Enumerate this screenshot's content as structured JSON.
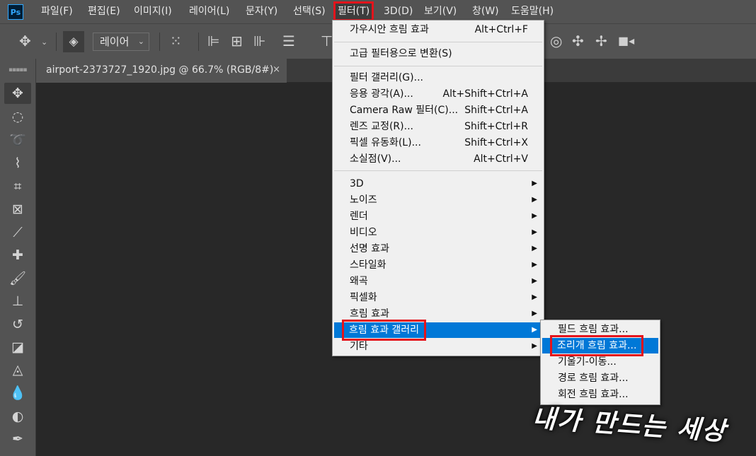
{
  "app": {
    "logo": "Ps"
  },
  "menubar": [
    {
      "label": "파일(F)",
      "active": false
    },
    {
      "label": "편집(E)",
      "active": false
    },
    {
      "label": "이미지(I)",
      "active": false
    },
    {
      "label": "레이어(L)",
      "active": false
    },
    {
      "label": "문자(Y)",
      "active": false
    },
    {
      "label": "선택(S)",
      "active": false
    },
    {
      "label": "필터(T)",
      "active": true
    },
    {
      "label": "3D(D)",
      "active": false
    },
    {
      "label": "보기(V)",
      "active": false
    },
    {
      "label": "창(W)",
      "active": false
    },
    {
      "label": "도움말(H)",
      "active": false
    }
  ],
  "options": {
    "target_select": "레이어"
  },
  "document_tab": {
    "title": "airport-2373727_1920.jpg @ 66.7% (RGB/8#)",
    "close": "×"
  },
  "filter_menu": {
    "items": [
      {
        "label": "가우시안 흐림 효과",
        "shortcut": "Alt+Ctrl+F"
      },
      {
        "label": "고급 필터용으로 변환(S)",
        "shortcut": ""
      },
      {
        "label": "필터 갤러리(G)...",
        "shortcut": ""
      },
      {
        "label": "응용 광각(A)...",
        "shortcut": "Alt+Shift+Ctrl+A"
      },
      {
        "label": "Camera Raw 필터(C)...",
        "shortcut": "Shift+Ctrl+A"
      },
      {
        "label": "렌즈 교정(R)...",
        "shortcut": "Shift+Ctrl+R"
      },
      {
        "label": "픽셀 유동화(L)...",
        "shortcut": "Shift+Ctrl+X"
      },
      {
        "label": "소실점(V)...",
        "shortcut": "Alt+Ctrl+V"
      },
      {
        "label": "3D",
        "submenu": true
      },
      {
        "label": "노이즈",
        "submenu": true
      },
      {
        "label": "렌더",
        "submenu": true
      },
      {
        "label": "비디오",
        "submenu": true
      },
      {
        "label": "선명 효과",
        "submenu": true
      },
      {
        "label": "스타일화",
        "submenu": true
      },
      {
        "label": "왜곡",
        "submenu": true
      },
      {
        "label": "픽셀화",
        "submenu": true
      },
      {
        "label": "흐림 효과",
        "submenu": true
      },
      {
        "label": "흐림 효과 갤러리",
        "submenu": true,
        "highlighted": true
      },
      {
        "label": "기타",
        "submenu": true
      }
    ]
  },
  "blur_gallery_submenu": {
    "items": [
      {
        "label": "필드 흐림 효과..."
      },
      {
        "label": "조리개 흐림 효과...",
        "highlighted": true
      },
      {
        "label": "기울기-이동..."
      },
      {
        "label": "경로 흐림 효과..."
      },
      {
        "label": "회전 흐림 효과..."
      }
    ]
  },
  "watermark": {
    "text": "내가 만드는 세상"
  },
  "colors": {
    "highlight": "#0078d7",
    "callout_red": "#e4141c",
    "panel": "#535353",
    "canvas": "#282828"
  }
}
